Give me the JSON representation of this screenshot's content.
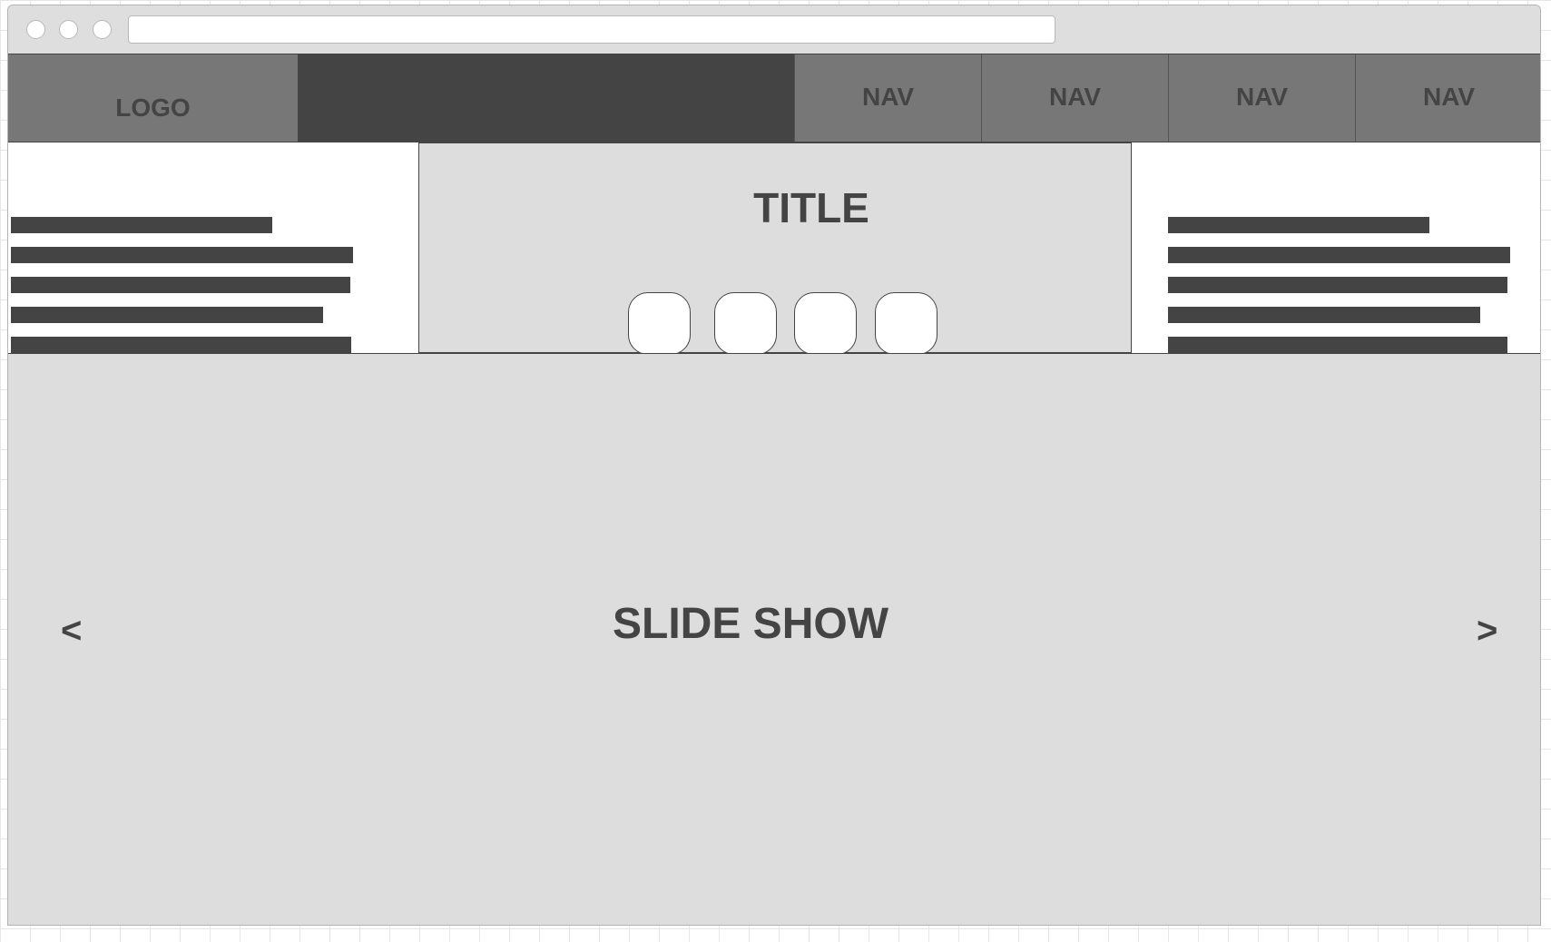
{
  "header": {
    "logo": "LOGO",
    "nav": [
      "NAV",
      "NAV",
      "NAV",
      "NAV"
    ]
  },
  "hero": {
    "title": "TITLE",
    "dot_count": 4
  },
  "slideshow": {
    "label": "SLIDE SHOW",
    "prev": "<",
    "next": ">"
  },
  "colors": {
    "dark": "#444444",
    "mid": "#777777",
    "light": "#dddddd",
    "white": "#ffffff"
  }
}
